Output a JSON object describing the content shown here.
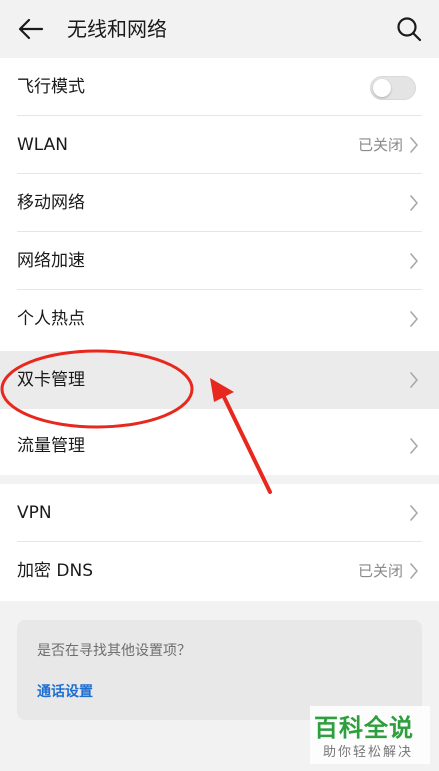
{
  "header": {
    "title": "无线和网络"
  },
  "group1": [
    {
      "label": "飞行模式",
      "control": "toggle",
      "toggle_on": false
    },
    {
      "label": "WLAN",
      "status": "已关闭"
    },
    {
      "label": "移动网络"
    },
    {
      "label": "网络加速"
    },
    {
      "label": "个人热点"
    },
    {
      "label": "双卡管理",
      "highlighted": true
    },
    {
      "label": "流量管理"
    }
  ],
  "group2": [
    {
      "label": "VPN"
    },
    {
      "label": "加密 DNS",
      "status": "已关闭"
    }
  ],
  "suggest": {
    "question": "是否在寻找其他设置项？",
    "link": "通话设置"
  },
  "watermark": {
    "main": "百科全说",
    "sub": "助你轻松解决"
  },
  "colors": {
    "link": "#1f6fd1",
    "annotation": "#e8281e",
    "watermark": "#2e9e3e",
    "status": "#8a8a8a"
  },
  "icons": {
    "back": "arrow-left-icon",
    "search": "search-icon",
    "chevron": "chevron-right-icon"
  }
}
